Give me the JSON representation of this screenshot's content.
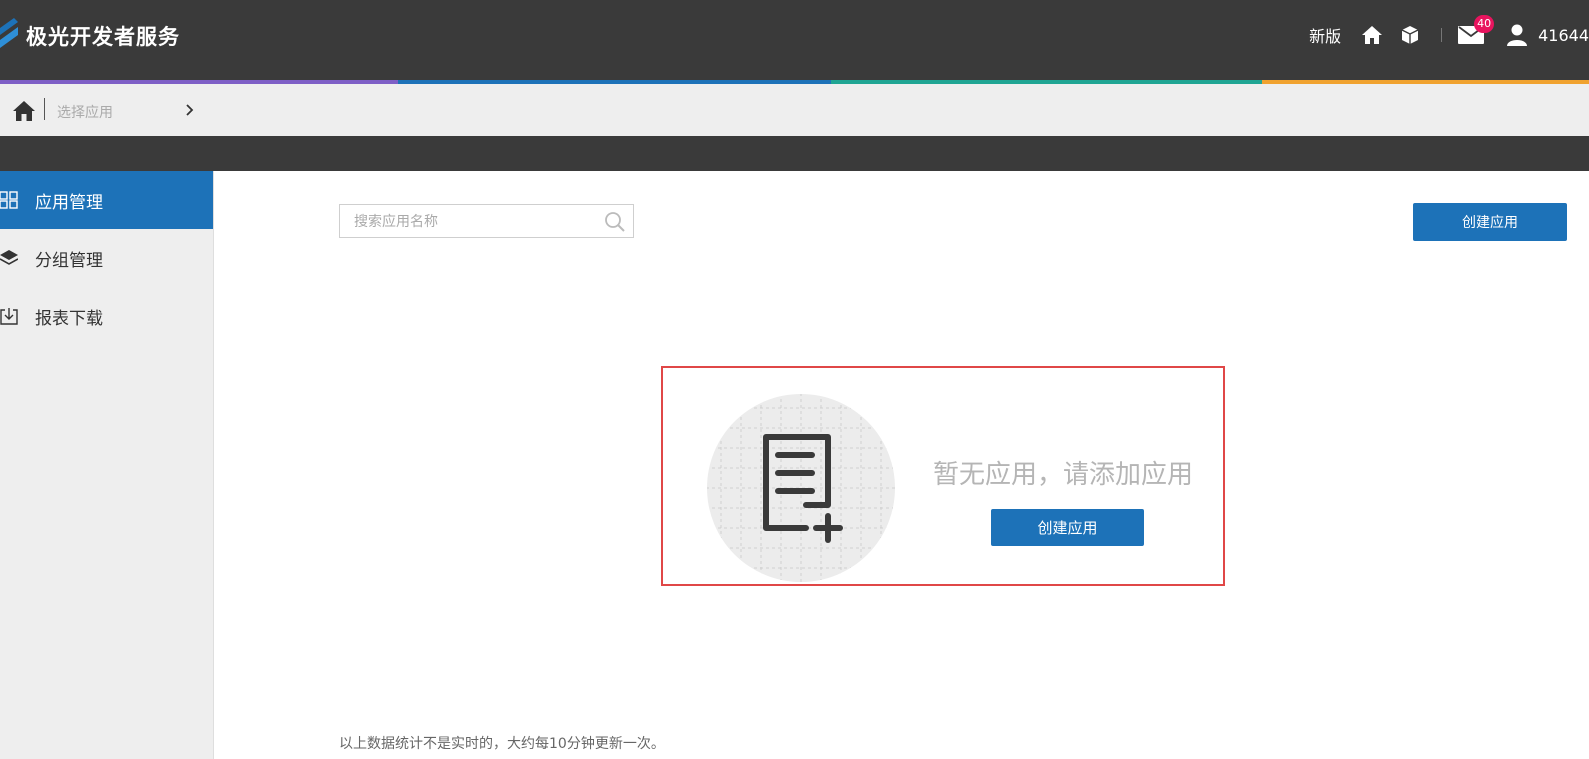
{
  "header": {
    "brand": "极光开发者服务",
    "new_version": "新版",
    "mail_badge": "40",
    "user": "41644",
    "stripe_colors": [
      "#7e5fc6",
      "#1d72b8",
      "#1fa593",
      "#f0a22f"
    ]
  },
  "breadcrumb": {
    "select_app": "选择应用"
  },
  "sidebar": {
    "items": [
      {
        "label": "应用管理",
        "icon": "grid-icon",
        "active": true
      },
      {
        "label": "分组管理",
        "icon": "layers-icon",
        "active": false
      },
      {
        "label": "报表下载",
        "icon": "download-icon",
        "active": false
      }
    ]
  },
  "main": {
    "search_placeholder": "搜索应用名称",
    "search_value": "",
    "create_button": "创建应用",
    "empty": {
      "message": "暂无应用，请添加应用",
      "create_button": "创建应用"
    },
    "footnote": "以上数据统计不是实时的，大约每10分钟更新一次。"
  },
  "colors": {
    "primary": "#1d72b8",
    "header_bg": "#3a3a3a",
    "highlight_border": "#e04747",
    "badge": "#e8145e"
  }
}
